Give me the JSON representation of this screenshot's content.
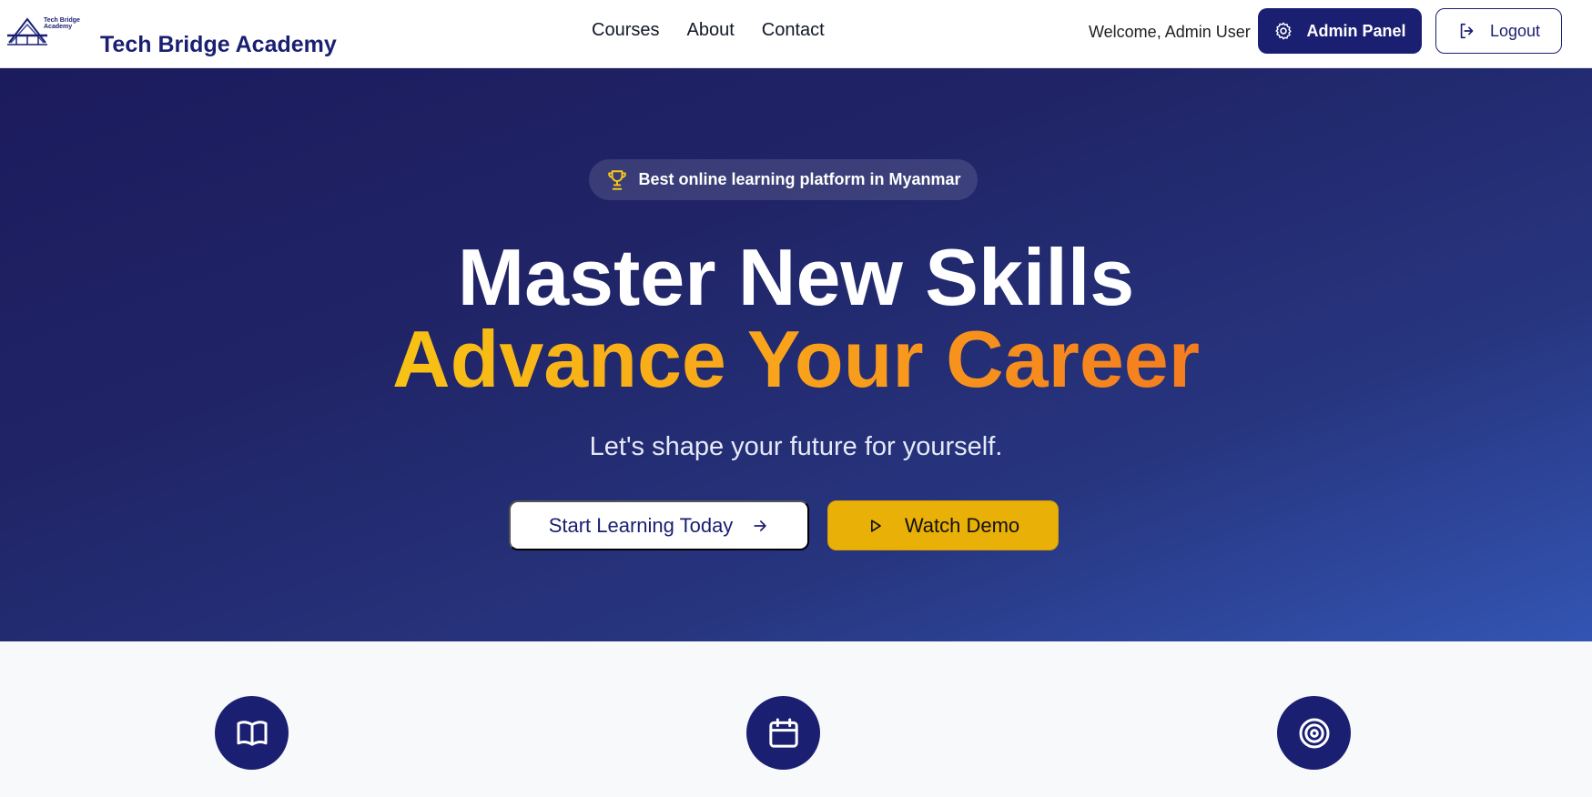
{
  "header": {
    "logo_text": "Tech Bridge Academy",
    "brand_name": "Tech Bridge Academy",
    "nav": [
      "Courses",
      "About",
      "Contact"
    ],
    "welcome": "Welcome, Admin User",
    "admin_label": "Admin Panel",
    "logout_label": "Logout"
  },
  "hero": {
    "badge": "Best online learning platform in Myanmar",
    "title_line1": "Master New Skills",
    "title_line2": "Advance Your Career",
    "subtitle": "Let's shape your future for yourself.",
    "cta_primary": "Start Learning Today",
    "cta_secondary": "Watch Demo"
  },
  "features": {
    "icons": [
      "book-icon",
      "calendar-icon",
      "target-icon"
    ]
  },
  "colors": {
    "primary": "#1a1f71",
    "accent": "#e9b007",
    "gradient_start": "#f8c215",
    "gradient_end": "#f47c20"
  }
}
